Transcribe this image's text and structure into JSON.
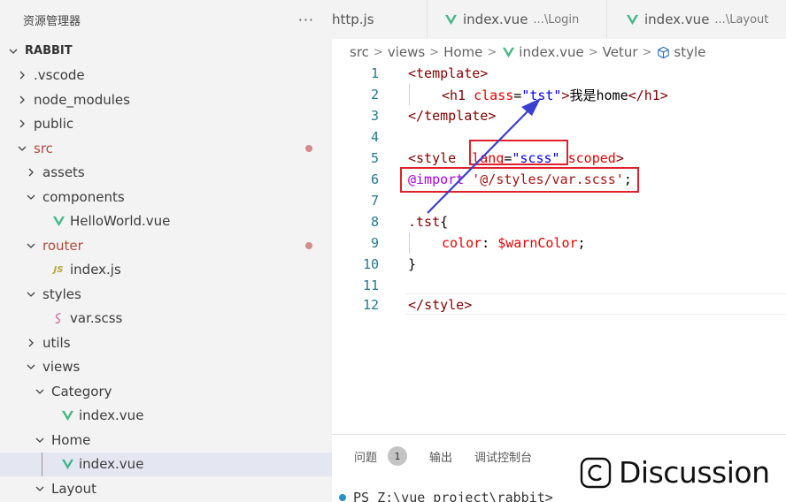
{
  "sidebar": {
    "title": "资源管理器",
    "more_label": "···",
    "project": "RABBIT",
    "items": [
      {
        "label": ".vscode",
        "level": 1,
        "kind": "folder",
        "expanded": false,
        "modified": false
      },
      {
        "label": "node_modules",
        "level": 1,
        "kind": "folder",
        "expanded": false,
        "modified": false
      },
      {
        "label": "public",
        "level": 1,
        "kind": "folder",
        "expanded": false,
        "modified": false
      },
      {
        "label": "src",
        "level": 1,
        "kind": "folder",
        "expanded": true,
        "modified": true
      },
      {
        "label": "assets",
        "level": 2,
        "kind": "folder",
        "expanded": false,
        "modified": false
      },
      {
        "label": "components",
        "level": 2,
        "kind": "folder",
        "expanded": true,
        "modified": false
      },
      {
        "label": "HelloWorld.vue",
        "level": 3,
        "kind": "vue",
        "modified": false
      },
      {
        "label": "router",
        "level": 2,
        "kind": "folder",
        "expanded": true,
        "modified": true
      },
      {
        "label": "index.js",
        "level": 3,
        "kind": "js",
        "modified": false
      },
      {
        "label": "styles",
        "level": 2,
        "kind": "folder",
        "expanded": true,
        "modified": false
      },
      {
        "label": "var.scss",
        "level": 3,
        "kind": "scss",
        "modified": false
      },
      {
        "label": "utils",
        "level": 2,
        "kind": "folder",
        "expanded": false,
        "modified": false
      },
      {
        "label": "views",
        "level": 2,
        "kind": "folder",
        "expanded": true,
        "modified": false
      },
      {
        "label": "Category",
        "level": 3,
        "kind": "folder",
        "expanded": true,
        "modified": false
      },
      {
        "label": "index.vue",
        "level": 4,
        "kind": "vue",
        "modified": false
      },
      {
        "label": "Home",
        "level": 3,
        "kind": "folder",
        "expanded": true,
        "modified": false
      },
      {
        "label": "index.vue",
        "level": 4,
        "kind": "vue",
        "modified": false,
        "selected": true
      },
      {
        "label": "Layout",
        "level": 3,
        "kind": "folder",
        "expanded": true,
        "modified": false
      }
    ]
  },
  "tabs": [
    {
      "label": "http.js",
      "desc": "",
      "icon": "js-file-icon"
    },
    {
      "label": "index.vue",
      "desc": "...\\Login",
      "icon": "vue-file-icon"
    },
    {
      "label": "index.vue",
      "desc": "...\\Layout",
      "icon": "vue-file-icon"
    }
  ],
  "breadcrumb": {
    "items": [
      "src",
      "views",
      "Home",
      "index.vue",
      "Vetur",
      "style"
    ]
  },
  "editor": {
    "line_numbers": [
      "1",
      "2",
      "3",
      "4",
      "5",
      "6",
      "7",
      "8",
      "9",
      "10",
      "11",
      "12"
    ],
    "lines": {
      "l1": {
        "open": "<",
        "tag": "template",
        "close": ">"
      },
      "l2": {
        "open": "<",
        "tag": "h1",
        "attr": "class",
        "eq": "=",
        "value": "\"tst\"",
        "close": ">",
        "text": "我是home",
        "end_open": "</",
        "end_tag": "h1",
        "end_close": ">"
      },
      "l3": {
        "open": "</",
        "tag": "template",
        "close": ">"
      },
      "l5": {
        "open": "<",
        "tag": "style",
        "attr": "lang",
        "eq": "=",
        "value": "\"scss\"",
        "attr2": "scoped",
        "close": ">"
      },
      "l6": {
        "at": "@import",
        "value": "'@/styles/var.scss'",
        "semi": ";"
      },
      "l8": {
        "selector": ".tst",
        "brace": "{"
      },
      "l9": {
        "prop": "color",
        "colon": ":",
        "var": "$warnColor",
        "semi": ";"
      },
      "l10": {
        "brace": "}"
      },
      "l12": {
        "open": "</",
        "tag": "style",
        "close": ">"
      }
    }
  },
  "panel": {
    "tabs": [
      "问题",
      "输出",
      "调试控制台"
    ],
    "problem_count": "1",
    "terminal_text": "PS Z:\\vue_project\\rabbit>"
  },
  "watermark": {
    "text": "Discussion",
    "logo": "C"
  },
  "colors": {
    "annotation_red": "#e0202a",
    "annotation_arrow": "#3b3fcf",
    "selection_bg": "#e4e6f1",
    "vue_green": "#41b883"
  }
}
